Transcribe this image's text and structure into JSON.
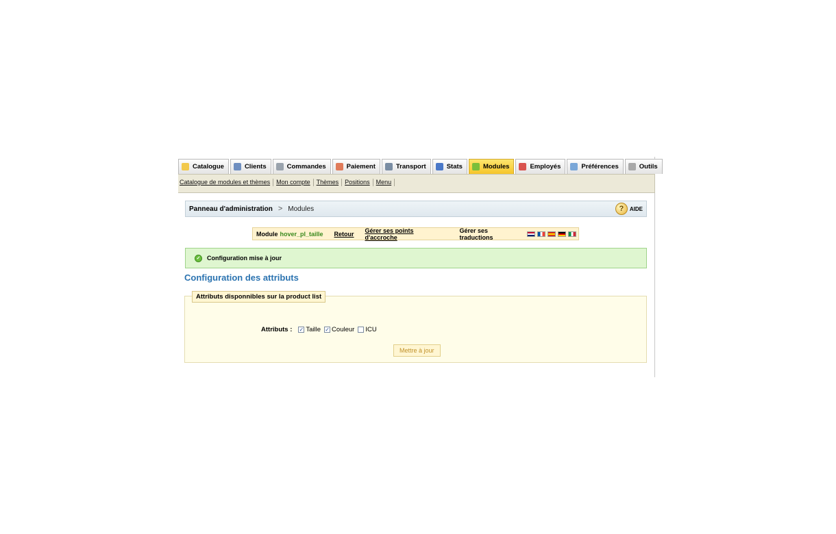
{
  "tabs": [
    {
      "label": "Catalogue",
      "icon": "folder-icon",
      "color": "#f2c94c"
    },
    {
      "label": "Clients",
      "icon": "user-icon",
      "color": "#6f8fc0"
    },
    {
      "label": "Commandes",
      "icon": "cart-icon",
      "color": "#9aa3ad"
    },
    {
      "label": "Paiement",
      "icon": "payment-icon",
      "color": "#e07b5a"
    },
    {
      "label": "Transport",
      "icon": "truck-icon",
      "color": "#7a8da3"
    },
    {
      "label": "Stats",
      "icon": "chart-icon",
      "color": "#4a78c8"
    },
    {
      "label": "Modules",
      "icon": "puzzle-icon",
      "color": "#7bbf3a",
      "active": true
    },
    {
      "label": "Employés",
      "icon": "employee-icon",
      "color": "#d9534f"
    },
    {
      "label": "Préférences",
      "icon": "preferences-icon",
      "color": "#7aa7d8"
    },
    {
      "label": "Outils",
      "icon": "wrench-icon",
      "color": "#a9a9a9"
    }
  ],
  "subnav": [
    "Catalogue de modules et thèmes",
    "Mon compte",
    "Thèmes",
    "Positions",
    "Menu"
  ],
  "breadcrumb": {
    "root": "Panneau d'administration",
    "separator": ">",
    "current": "Modules",
    "help": "AIDE"
  },
  "module_bar": {
    "prefix": "Module",
    "name": "hover_pl_taille",
    "back": "Retour",
    "hooks": "Gérer ses points d'accroche",
    "translations": "Gérer ses traductions",
    "flags": [
      "en",
      "fr",
      "es",
      "de",
      "it"
    ]
  },
  "success": {
    "message": "Configuration mise à jour",
    "color": "#dff6d0"
  },
  "section_title": "Configuration des attributs",
  "fieldset": {
    "legend": "Attributs disponnibles sur la product list",
    "label": "Attributs :",
    "options": [
      {
        "label": "Taille",
        "checked": true
      },
      {
        "label": "Couleur",
        "checked": true
      },
      {
        "label": "ICU",
        "checked": false
      }
    ],
    "submit": "Mettre à jour"
  },
  "accent": "#2b73b0"
}
